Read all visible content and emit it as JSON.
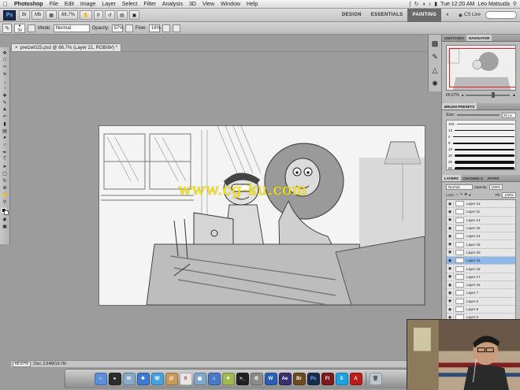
{
  "menubar": {
    "app_name": "Photoshop",
    "items": [
      "File",
      "Edit",
      "Image",
      "Layer",
      "Select",
      "Filter",
      "Analysis",
      "3D",
      "View",
      "Window",
      "Help"
    ],
    "clock": "Tue 12:20 AM",
    "user": "Leo Matsuda"
  },
  "appbar": {
    "logo": "Ps",
    "zoom_value": "66.7%",
    "workspaces": [
      "DESIGN",
      "ESSENTIALS",
      "PAINTING"
    ],
    "active_workspace": "PAINTING",
    "cs_live": "CS Live"
  },
  "options": {
    "brush_size": "30",
    "mode_label": "Mode:",
    "mode_value": "Normal",
    "opacity_label": "Opacity:",
    "opacity_value": "57%",
    "flow_label": "Flow:",
    "flow_value": "16%"
  },
  "document": {
    "tab_title": "pretzel025.psd @ 66.7% (Layer 21, RGB/8#) *"
  },
  "watermark": "www.cg-ku.com",
  "status": {
    "zoom": "66.67%",
    "doc_info": "Doc: 2.64M/19.7M"
  },
  "panels": {
    "nav_tabs": [
      "SWATCHES",
      "NAVIGATOR"
    ],
    "nav_zoom": "66.67%",
    "brush_tab": "BRUSH PRESETS",
    "brush_size_label": "Size:",
    "brush_size_value": "30 px",
    "brush_presets": [
      "100",
      "13",
      "4",
      "8",
      "10",
      "20",
      "30",
      "50"
    ],
    "layer_tabs": [
      "LAYERS",
      "CHANNELS",
      "PATHS"
    ],
    "blend_mode": "Normal",
    "opacity_label": "Opacity:",
    "opacity_value": "100%",
    "lock_label": "Lock:",
    "fill_label": "Fill:",
    "fill_value": "100%",
    "layers": [
      "Layer 12",
      "Layer 11",
      "Layer 13",
      "Layer 16",
      "Layer 14",
      "Layer 18",
      "Layer 20",
      "Layer 21",
      "Layer 19",
      "Layer 17",
      "Layer 15",
      "Layer 7",
      "Layer 6",
      "Layer 8",
      "Layer 5"
    ],
    "selected_layer": "Layer 21"
  },
  "dock": {
    "apps": [
      "Finder",
      "Dashboard",
      "Mail",
      "Safari",
      "iChat",
      "Address Book",
      "iCal",
      "Preview",
      "iTunes",
      "iPhoto",
      "Terminal",
      "System Preferences",
      "Word",
      "After Effects",
      "Bridge",
      "Photoshop",
      "Flash",
      "Skype",
      "Acrobat",
      "Trash"
    ]
  },
  "colors": {
    "selected_layer": "#8eb8ea",
    "watermark": "#ffea00",
    "navigator_frame": "#e31c1c"
  }
}
